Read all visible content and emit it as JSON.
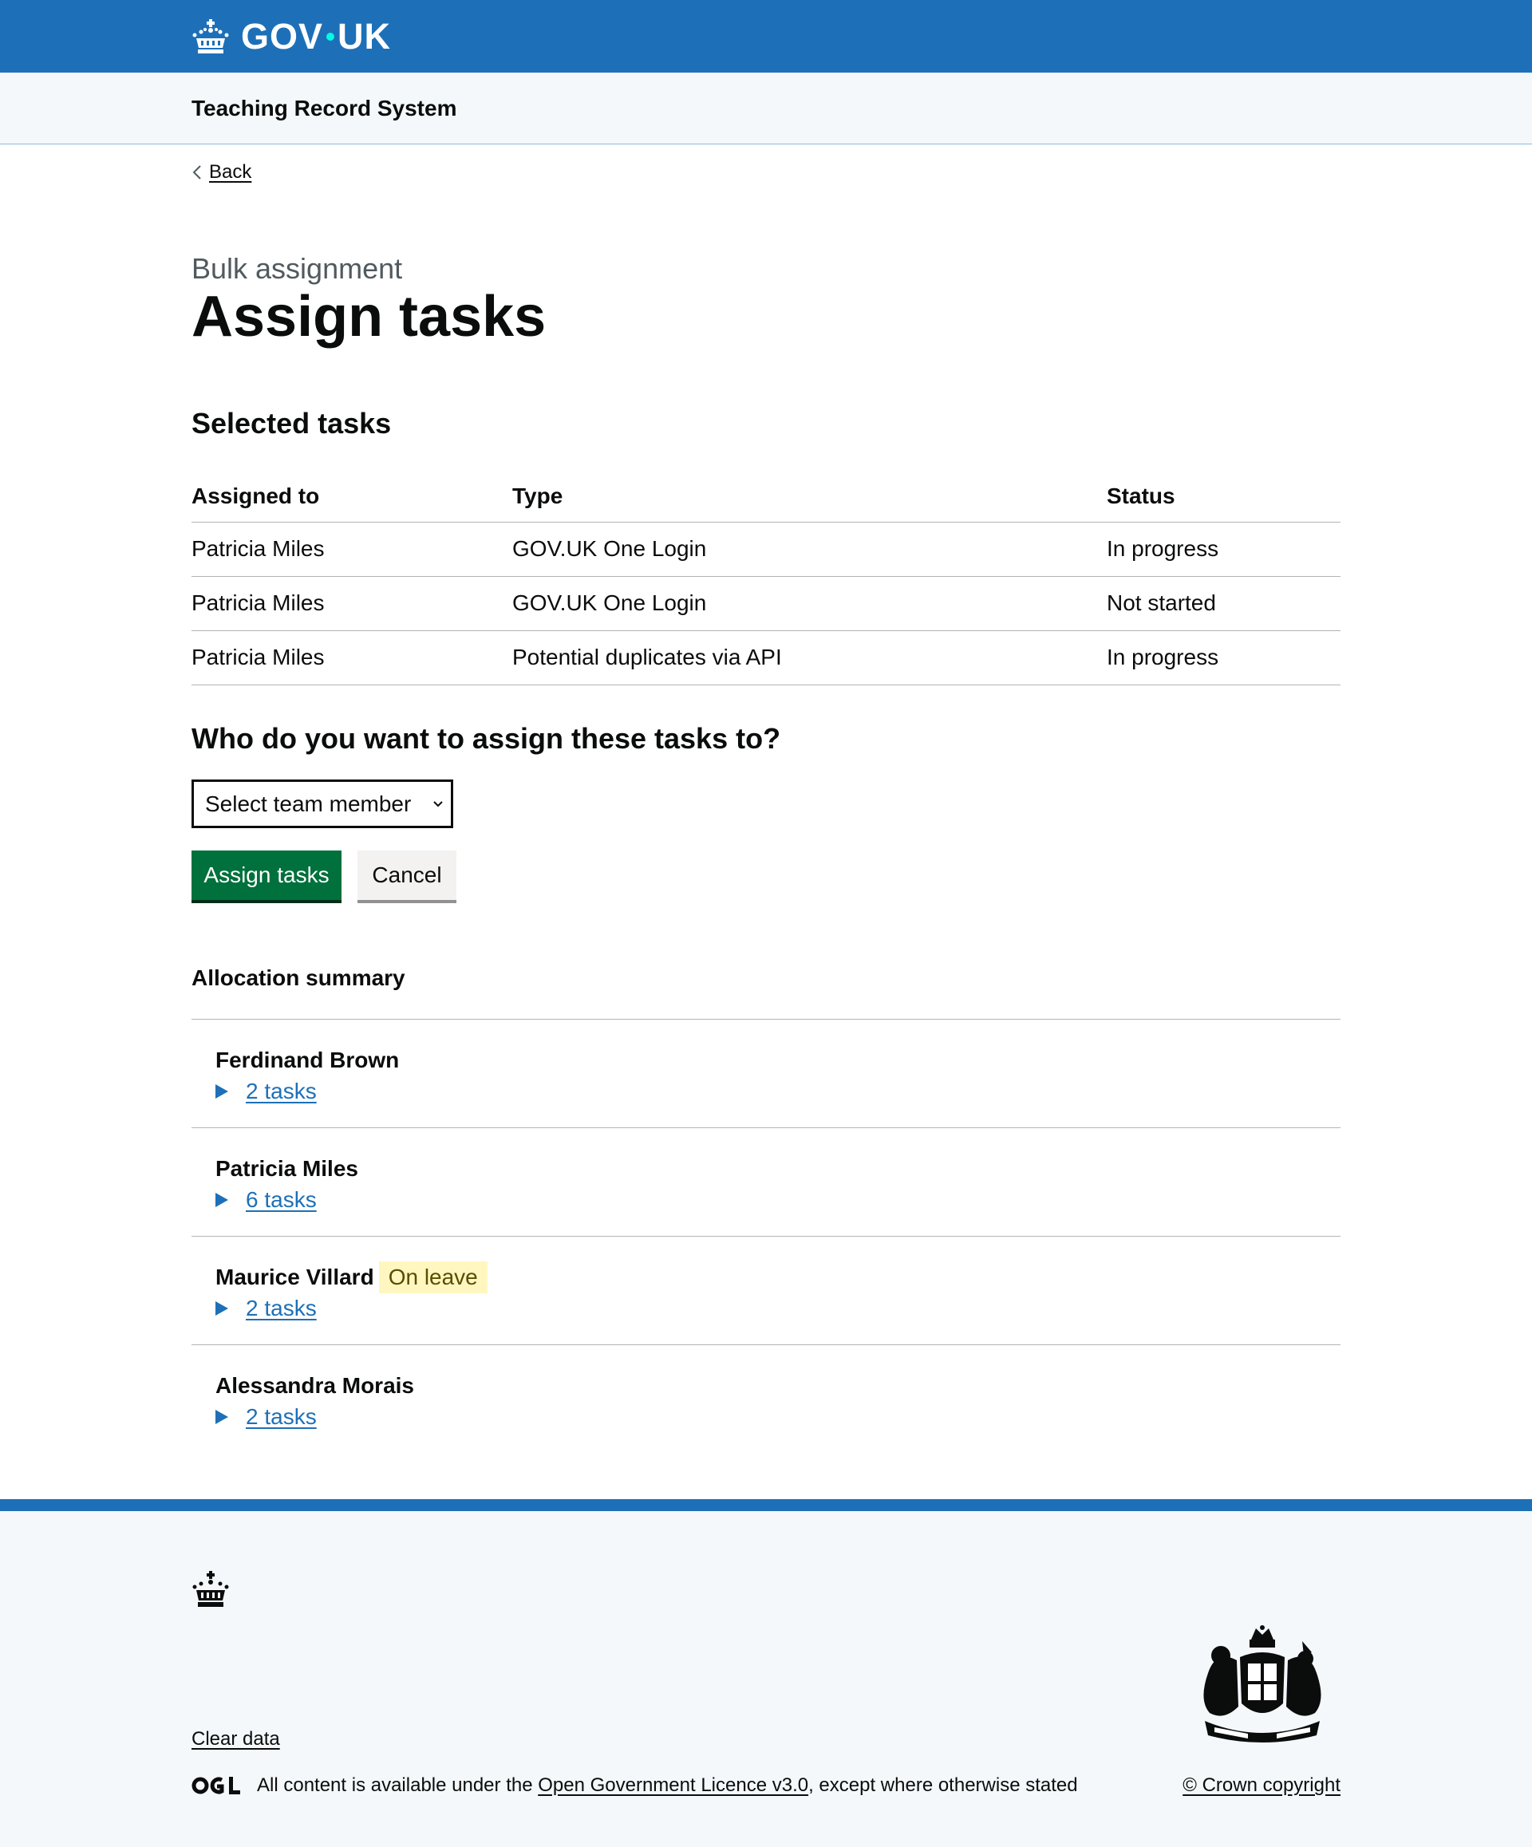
{
  "header": {
    "logo_text_left": "GOV",
    "logo_text_right": "UK",
    "service_name": "Teaching Record System",
    "brand_color": "#1d70b8"
  },
  "back_link": "Back",
  "caption": "Bulk assignment",
  "page_title": "Assign tasks",
  "selected_tasks": {
    "heading": "Selected tasks",
    "columns": [
      "Assigned to",
      "Type",
      "Status"
    ],
    "rows": [
      [
        "Patricia Miles",
        "GOV.UK One Login",
        "In progress"
      ],
      [
        "Patricia Miles",
        "GOV.UK One Login",
        "Not started"
      ],
      [
        "Patricia Miles",
        "Potential duplicates via API",
        "In progress"
      ]
    ]
  },
  "assign": {
    "question": "Who do you want to assign these tasks to?",
    "select_value": "Select team member",
    "submit_label": "Assign tasks",
    "cancel_label": "Cancel"
  },
  "allocation": {
    "heading": "Allocation summary",
    "members": [
      {
        "name": "Ferdinand Brown",
        "tag": "",
        "tasks_label": "2 tasks"
      },
      {
        "name": "Patricia Miles",
        "tag": "",
        "tasks_label": "6 tasks"
      },
      {
        "name": "Maurice Villard",
        "tag": "On leave",
        "tasks_label": "2 tasks"
      },
      {
        "name": "Alessandra Morais",
        "tag": "",
        "tasks_label": "2 tasks"
      }
    ]
  },
  "footer": {
    "clear_data": "Clear data",
    "licence_prefix": "All content is available under the ",
    "licence_link": "Open Government Licence v3.0",
    "licence_suffix": ", except where otherwise stated",
    "copyright": "© Crown copyright"
  }
}
